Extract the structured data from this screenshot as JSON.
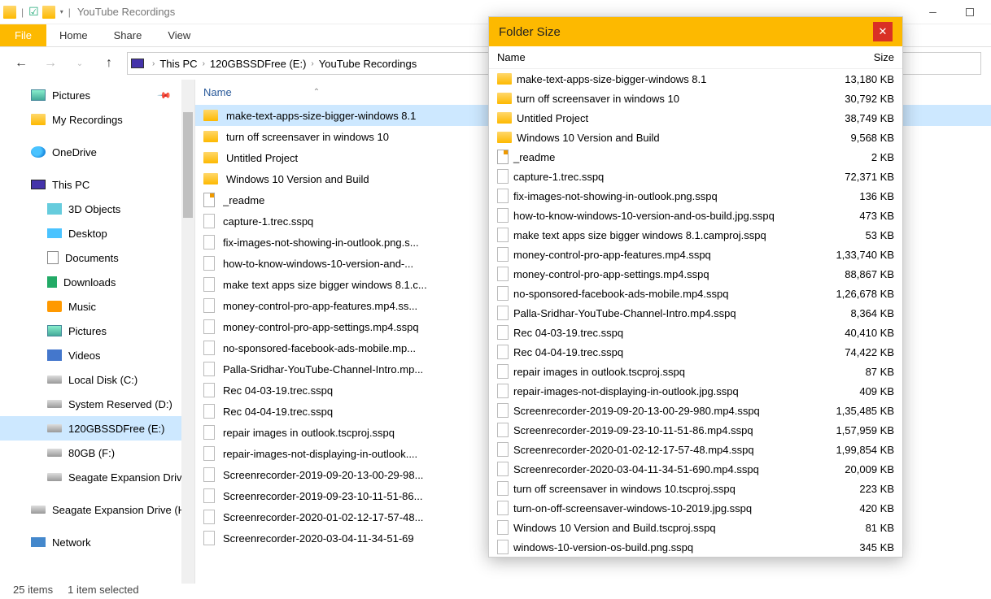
{
  "titlebar": {
    "title": "YouTube Recordings"
  },
  "ribbon": {
    "file": "File",
    "home": "Home",
    "share": "Share",
    "view": "View"
  },
  "breadcrumb": [
    "This PC",
    "120GBSSDFree (E:)",
    "YouTube Recordings"
  ],
  "nav": [
    {
      "icon": "pic",
      "label": "Pictures",
      "pinned": true
    },
    {
      "icon": "folder",
      "label": "My Recordings"
    },
    {
      "icon": "onedrive",
      "label": "OneDrive",
      "group": true
    },
    {
      "icon": "pc",
      "label": "This PC",
      "group": true
    },
    {
      "icon": "3d",
      "label": "3D Objects",
      "indent": true
    },
    {
      "icon": "desk",
      "label": "Desktop",
      "indent": true
    },
    {
      "icon": "doc",
      "label": "Documents",
      "indent": true
    },
    {
      "icon": "dl",
      "label": "Downloads",
      "indent": true
    },
    {
      "icon": "music",
      "label": "Music",
      "indent": true
    },
    {
      "icon": "pic",
      "label": "Pictures",
      "indent": true
    },
    {
      "icon": "vid",
      "label": "Videos",
      "indent": true
    },
    {
      "icon": "disk",
      "label": "Local Disk (C:)",
      "indent": true
    },
    {
      "icon": "disk",
      "label": "System Reserved (D:)",
      "indent": true
    },
    {
      "icon": "disk",
      "label": "120GBSSDFree (E:)",
      "indent": true,
      "sel": true
    },
    {
      "icon": "disk",
      "label": "80GB (F:)",
      "indent": true
    },
    {
      "icon": "disk",
      "label": "Seagate Expansion Drive",
      "indent": true
    },
    {
      "icon": "disk",
      "label": "Seagate Expansion Drive (H",
      "group": true
    },
    {
      "icon": "net",
      "label": "Network",
      "group": true
    }
  ],
  "content_header": {
    "name": "Name"
  },
  "files": [
    {
      "icon": "folder",
      "name": "make-text-apps-size-bigger-windows 8.1",
      "sel": true
    },
    {
      "icon": "folder",
      "name": "turn off screensaver in windows 10"
    },
    {
      "icon": "folder",
      "name": "Untitled Project"
    },
    {
      "icon": "folder",
      "name": "Windows 10 Version and Build"
    },
    {
      "icon": "txt",
      "name": "_readme"
    },
    {
      "icon": "file",
      "name": "capture-1.trec.sspq"
    },
    {
      "icon": "file",
      "name": "fix-images-not-showing-in-outlook.png.s..."
    },
    {
      "icon": "file",
      "name": "how-to-know-windows-10-version-and-..."
    },
    {
      "icon": "file",
      "name": "make text apps size bigger windows 8.1.c..."
    },
    {
      "icon": "file",
      "name": "money-control-pro-app-features.mp4.ss..."
    },
    {
      "icon": "file",
      "name": "money-control-pro-app-settings.mp4.sspq"
    },
    {
      "icon": "file",
      "name": "no-sponsored-facebook-ads-mobile.mp..."
    },
    {
      "icon": "file",
      "name": "Palla-Sridhar-YouTube-Channel-Intro.mp..."
    },
    {
      "icon": "file",
      "name": "Rec 04-03-19.trec.sspq"
    },
    {
      "icon": "file",
      "name": "Rec 04-04-19.trec.sspq"
    },
    {
      "icon": "file",
      "name": "repair images in outlook.tscproj.sspq"
    },
    {
      "icon": "file",
      "name": "repair-images-not-displaying-in-outlook...."
    },
    {
      "icon": "file",
      "name": "Screenrecorder-2019-09-20-13-00-29-98..."
    },
    {
      "icon": "file",
      "name": "Screenrecorder-2019-09-23-10-11-51-86..."
    },
    {
      "icon": "file",
      "name": "Screenrecorder-2020-01-02-12-17-57-48..."
    },
    {
      "icon": "file",
      "name": "Screenrecorder-2020-03-04-11-34-51-69"
    }
  ],
  "status": {
    "count": "25 items",
    "selected": "1 item selected"
  },
  "popup": {
    "title": "Folder Size",
    "col_name": "Name",
    "col_size": "Size",
    "items": [
      {
        "icon": "folder",
        "name": "make-text-apps-size-bigger-windows 8.1",
        "size": "13,180 KB"
      },
      {
        "icon": "folder",
        "name": "turn off screensaver in windows 10",
        "size": "30,792 KB"
      },
      {
        "icon": "folder",
        "name": "Untitled Project",
        "size": "38,749 KB"
      },
      {
        "icon": "folder",
        "name": "Windows 10 Version and Build",
        "size": "9,568 KB"
      },
      {
        "icon": "txt",
        "name": "_readme",
        "size": "2 KB"
      },
      {
        "icon": "file",
        "name": "capture-1.trec.sspq",
        "size": "72,371 KB"
      },
      {
        "icon": "file",
        "name": "fix-images-not-showing-in-outlook.png.sspq",
        "size": "136 KB"
      },
      {
        "icon": "file",
        "name": "how-to-know-windows-10-version-and-os-build.jpg.sspq",
        "size": "473 KB"
      },
      {
        "icon": "file",
        "name": "make text apps size bigger windows 8.1.camproj.sspq",
        "size": "53 KB"
      },
      {
        "icon": "file",
        "name": "money-control-pro-app-features.mp4.sspq",
        "size": "1,33,740 KB"
      },
      {
        "icon": "file",
        "name": "money-control-pro-app-settings.mp4.sspq",
        "size": "88,867 KB"
      },
      {
        "icon": "file",
        "name": "no-sponsored-facebook-ads-mobile.mp4.sspq",
        "size": "1,26,678 KB"
      },
      {
        "icon": "file",
        "name": "Palla-Sridhar-YouTube-Channel-Intro.mp4.sspq",
        "size": "8,364 KB"
      },
      {
        "icon": "file",
        "name": "Rec 04-03-19.trec.sspq",
        "size": "40,410 KB"
      },
      {
        "icon": "file",
        "name": "Rec 04-04-19.trec.sspq",
        "size": "74,422 KB"
      },
      {
        "icon": "file",
        "name": "repair images in outlook.tscproj.sspq",
        "size": "87 KB"
      },
      {
        "icon": "file",
        "name": "repair-images-not-displaying-in-outlook.jpg.sspq",
        "size": "409 KB"
      },
      {
        "icon": "file",
        "name": "Screenrecorder-2019-09-20-13-00-29-980.mp4.sspq",
        "size": "1,35,485 KB"
      },
      {
        "icon": "file",
        "name": "Screenrecorder-2019-09-23-10-11-51-86.mp4.sspq",
        "size": "1,57,959 KB"
      },
      {
        "icon": "file",
        "name": "Screenrecorder-2020-01-02-12-17-57-48.mp4.sspq",
        "size": "1,99,854 KB"
      },
      {
        "icon": "file",
        "name": "Screenrecorder-2020-03-04-11-34-51-690.mp4.sspq",
        "size": "20,009 KB"
      },
      {
        "icon": "file",
        "name": "turn off screensaver in windows 10.tscproj.sspq",
        "size": "223 KB"
      },
      {
        "icon": "file",
        "name": "turn-on-off-screensaver-windows-10-2019.jpg.sspq",
        "size": "420 KB"
      },
      {
        "icon": "file",
        "name": "Windows 10 Version and Build.tscproj.sspq",
        "size": "81 KB"
      },
      {
        "icon": "file",
        "name": "windows-10-version-os-build.png.sspq",
        "size": "345 KB"
      }
    ]
  }
}
